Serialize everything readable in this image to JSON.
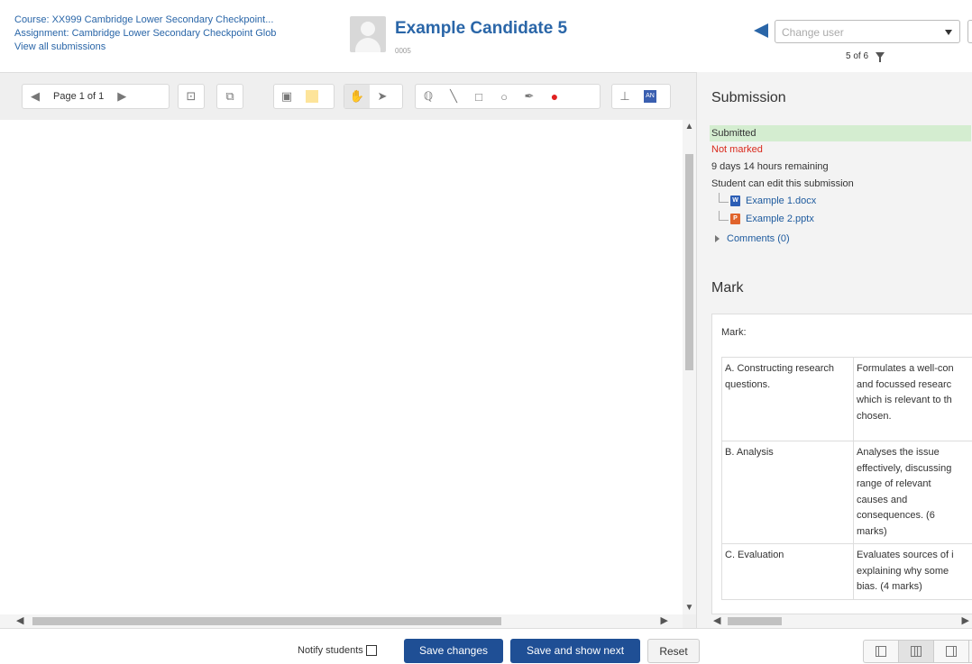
{
  "header": {
    "course_link": "Course: XX999 Cambridge Lower Secondary Checkpoint...",
    "assignment_link": "Assignment: Cambridge Lower Secondary Checkpoint Glob",
    "view_all_link": "View all submissions",
    "candidate_name": "Example Candidate 5",
    "candidate_id": "0005",
    "change_user_placeholder": "Change user",
    "user_count": "5 of 6"
  },
  "toolbar": {
    "page_label": "Page 1 of 1"
  },
  "submission": {
    "title": "Submission",
    "status": "Submitted",
    "grade_status": "Not marked",
    "time_remaining": "9 days 14 hours remaining",
    "edit_note": "Student can edit this submission",
    "files": [
      {
        "name": "Example 1.docx",
        "type": "docx"
      },
      {
        "name": "Example 2.pptx",
        "type": "pptx"
      }
    ],
    "comments": "Comments (0)"
  },
  "mark": {
    "title": "Mark",
    "label": "Mark:",
    "rubric": [
      {
        "criterion": "A. Constructing research questions.",
        "level": "Formulates a well-con\nand focussed researc\nwhich is relevant to th\nchosen."
      },
      {
        "criterion": "B. Analysis",
        "level": "Analyses the issue\neffectively, discussing\nrange of relevant\ncauses and\nconsequences. (6\nmarks)"
      },
      {
        "criterion": "C. Evaluation",
        "level": "Evaluates sources of i\nexplaining why some\nbias. (4 marks)"
      }
    ]
  },
  "footer": {
    "notify_label": "Notify students",
    "save_changes": "Save changes",
    "save_next": "Save and show next",
    "reset": "Reset"
  },
  "colors": {
    "link": "#2a66a8",
    "primary_button": "#1f4f95",
    "submitted_bg": "#d4edd0",
    "not_marked": "#d9291c"
  }
}
